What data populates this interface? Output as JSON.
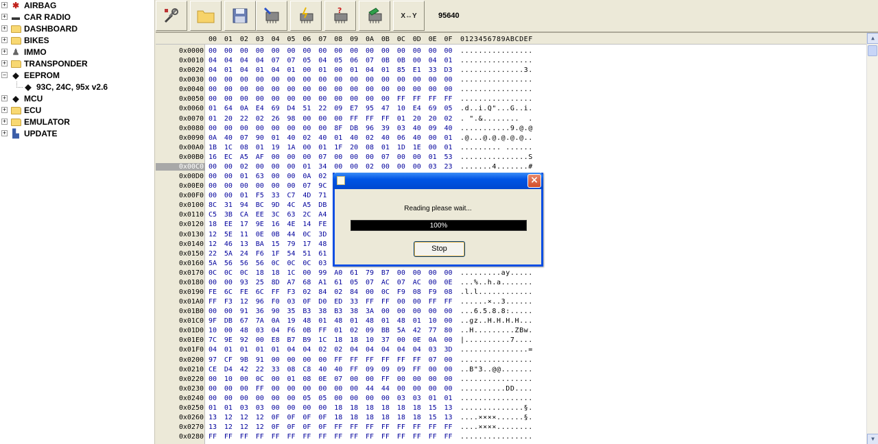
{
  "tree": [
    {
      "label": "AIRBAG",
      "icon": "airbag-icon",
      "expander": "+"
    },
    {
      "label": "CAR RADIO",
      "icon": "radio-icon",
      "expander": "+"
    },
    {
      "label": "DASHBOARD",
      "icon": "folder-icon",
      "expander": "+"
    },
    {
      "label": "BIKES",
      "icon": "folder-icon",
      "expander": "+"
    },
    {
      "label": "IMMO",
      "icon": "immo-icon",
      "expander": "+"
    },
    {
      "label": "TRANSPONDER",
      "icon": "folder-icon",
      "expander": "+"
    },
    {
      "label": "EEPROM",
      "icon": "chip-icon",
      "expander": "−"
    },
    {
      "label": "93C, 24C, 95x v2.6",
      "icon": "chip-icon",
      "child": true
    },
    {
      "label": "MCU",
      "icon": "chip-icon",
      "expander": "+"
    },
    {
      "label": "ECU",
      "icon": "folder-icon",
      "expander": "+"
    },
    {
      "label": "EMULATOR",
      "icon": "folder-icon",
      "expander": "+"
    },
    {
      "label": "UPDATE",
      "icon": "update-icon",
      "expander": "+"
    }
  ],
  "toolbar": {
    "swap_label": "X↔Y",
    "value": "95640"
  },
  "hex": {
    "header_bytes": [
      "00",
      "01",
      "02",
      "03",
      "04",
      "05",
      "06",
      "07",
      "08",
      "09",
      "0A",
      "0B",
      "0C",
      "0D",
      "0E",
      "0F"
    ],
    "ascii_header": "0123456789ABCDEF",
    "selected_address": "0x00C0",
    "rows": [
      {
        "addr": "0x0000",
        "bytes": "00 00 00 00 00 00 00 00 00 00 00 00 00 00 00 00",
        "ascii": "................"
      },
      {
        "addr": "0x0010",
        "bytes": "04 04 04 04 07 07 05 04 05 06 07 0B 0B 00 04 01",
        "ascii": "................"
      },
      {
        "addr": "0x0020",
        "bytes": "04 01 04 01 04 01 00 01 00 01 04 01 85 E1 33 D3",
        "ascii": "..............3."
      },
      {
        "addr": "0x0030",
        "bytes": "00 00 00 00 00 00 00 00 00 00 00 00 00 00 00 00",
        "ascii": "................"
      },
      {
        "addr": "0x0040",
        "bytes": "00 00 00 00 00 00 00 00 00 00 00 00 00 00 00 00",
        "ascii": "................"
      },
      {
        "addr": "0x0050",
        "bytes": "00 00 00 00 00 00 00 00 00 00 00 00 FF FF FF FF",
        "ascii": "................"
      },
      {
        "addr": "0x0060",
        "bytes": "01 64 0A E4 69 D4 51 22 09 E7 95 47 10 E4 69 05",
        "ascii": ".d..i.Q\"...G..i."
      },
      {
        "addr": "0x0070",
        "bytes": "01 20 22 02 26 98 00 00 00 FF FF FF 01 20 20 02",
        "ascii": ". \".&........  ."
      },
      {
        "addr": "0x0080",
        "bytes": "00 00 00 00 00 00 00 00 8F DB 96 39 03 40 09 40",
        "ascii": "...........9.@.@"
      },
      {
        "addr": "0x0090",
        "bytes": "0A 40 07 90 01 40 02 40 01 40 02 40 06 40 00 01",
        "ascii": ".@...@.@.@.@.@.."
      },
      {
        "addr": "0x00A0",
        "bytes": "1B 1C 08 01 19 1A 00 01 1F 20 08 01 1D 1E 00 01",
        "ascii": "......... ......"
      },
      {
        "addr": "0x00B0",
        "bytes": "16 EC A5 AF 00 00 00 07 00 00 00 07 00 00 01 53",
        "ascii": "...............S"
      },
      {
        "addr": "0x00C0",
        "bytes": "00 00 02 00 00 00 01 34 00 00 02 00 00 00 03 23",
        "ascii": ".......4.......#"
      },
      {
        "addr": "0x00D0",
        "bytes": "00 00 01 63 00 00 0A 02",
        "ascii": ""
      },
      {
        "addr": "0x00E0",
        "bytes": "00 00 00 00 00 00 07 9C",
        "ascii": ""
      },
      {
        "addr": "0x00F0",
        "bytes": "00 00 01 F5 33 C7 4D 71",
        "ascii": ""
      },
      {
        "addr": "0x0100",
        "bytes": "8C 31 94 BC 9D 4C A5 DB",
        "ascii": ""
      },
      {
        "addr": "0x0110",
        "bytes": "C5 3B CA EE 3C 63 2C A4",
        "ascii": ""
      },
      {
        "addr": "0x0120",
        "bytes": "18 EE 17 9E 16 4E 14 FE",
        "ascii": ""
      },
      {
        "addr": "0x0130",
        "bytes": "12 5E 11 0E 0B 44 0C 3D",
        "ascii": ""
      },
      {
        "addr": "0x0140",
        "bytes": "12 46 13 BA 15 79 17 48",
        "ascii": ""
      },
      {
        "addr": "0x0150",
        "bytes": "22 5A 24 F6 1F 54 51 61",
        "ascii": ""
      },
      {
        "addr": "0x0160",
        "bytes": "5A 56 56 56 0C 0C 0C 03",
        "ascii": ""
      },
      {
        "addr": "0x0170",
        "bytes": "0C 0C 0C 18 18 1C 00 99 A0 61 79 B7 00 00 00 00",
        "ascii": ".........ay....."
      },
      {
        "addr": "0x0180",
        "bytes": "00 00 93 25 8D A7 68 A1 61 05 07 AC 07 AC 00 0E",
        "ascii": "...%..h.a......."
      },
      {
        "addr": "0x0190",
        "bytes": "FE 6C FE 6C FF F3 02 84 02 84 00 0C F9 08 F9 08",
        "ascii": ".l.l............"
      },
      {
        "addr": "0x01A0",
        "bytes": "FF F3 12 96 F0 03 0F D0 ED 33 FF FF 00 00 FF FF",
        "ascii": "......×..3......"
      },
      {
        "addr": "0x01B0",
        "bytes": "00 00 91 36 90 35 B3 38 B3 38 3A 00 00 00 00 00",
        "ascii": "...6.5.8.8:....."
      },
      {
        "addr": "0x01C0",
        "bytes": "9F DB 67 7A 0A 19 48 01 48 01 48 01 48 01 10 00",
        "ascii": "..gz..H.H.H.H..."
      },
      {
        "addr": "0x01D0",
        "bytes": "10 00 48 03 04 F6 0B FF 01 02 09 BB 5A 42 77 80",
        "ascii": "..H.........ZBw."
      },
      {
        "addr": "0x01E0",
        "bytes": "7C 9E 92 00 E8 B7 B9 1C 18 18 10 37 00 0E 0A 00",
        "ascii": "|..........7...."
      },
      {
        "addr": "0x01F0",
        "bytes": "04 01 01 01 01 04 04 02 02 04 04 04 04 04 03 3D",
        "ascii": "...............="
      },
      {
        "addr": "0x0200",
        "bytes": "97 CF 9B 91 00 00 00 00 FF FF FF FF FF FF 07 00",
        "ascii": "................"
      },
      {
        "addr": "0x0210",
        "bytes": "CE D4 42 22 33 08 C8 40 40 FF 09 09 09 FF 00 00",
        "ascii": "..B\"3..@@......."
      },
      {
        "addr": "0x0220",
        "bytes": "00 10 00 0C 00 01 08 0E 07 00 00 FF 00 00 00 00",
        "ascii": "................"
      },
      {
        "addr": "0x0230",
        "bytes": "00 00 00 FF 00 00 00 00 00 00 44 44 00 00 00 00",
        "ascii": "..........DD...."
      },
      {
        "addr": "0x0240",
        "bytes": "00 00 00 00 00 00 05 05 00 00 00 00 03 03 01 01",
        "ascii": "................"
      },
      {
        "addr": "0x0250",
        "bytes": "01 01 03 03 00 00 00 00 18 18 18 18 18 18 15 13",
        "ascii": "..............§."
      },
      {
        "addr": "0x0260",
        "bytes": "13 12 12 12 0F 0F 0F 0F 18 18 18 18 18 18 15 13",
        "ascii": "....××××......§."
      },
      {
        "addr": "0x0270",
        "bytes": "13 12 12 12 0F 0F 0F 0F FF FF FF FF FF FF FF FF",
        "ascii": "....××××........"
      },
      {
        "addr": "0x0280",
        "bytes": "FF FF FF FF FF FF FF FF FF FF FF FF FF FF FF FF",
        "ascii": "................"
      }
    ]
  },
  "dialog": {
    "message": "Reading please wait...",
    "progress_text": "100%",
    "progress_value": 1.0,
    "stop_label": "Stop"
  },
  "colors": {
    "hex_byte": "#00009c",
    "dialog_title": "#0055e5",
    "progress": "#000000"
  }
}
